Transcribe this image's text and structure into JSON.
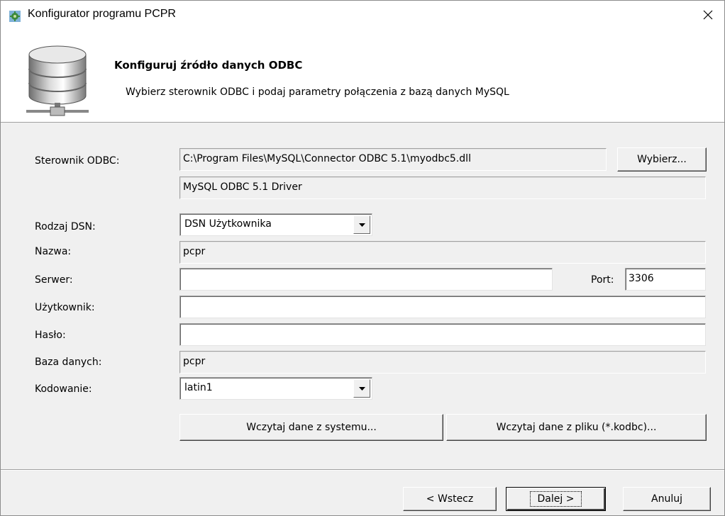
{
  "window": {
    "title": "Konfigurator programu PCPR"
  },
  "header": {
    "title": "Konfiguruj źródło danych ODBC",
    "subtitle": "Wybierz sterownik ODBC i podaj parametry połączenia z bazą danych MySQL"
  },
  "form": {
    "driver_label": "Sterownik ODBC:",
    "driver_path": "C:\\Program Files\\MySQL\\Connector ODBC 5.1\\myodbc5.dll",
    "driver_name": "MySQL ODBC 5.1 Driver",
    "choose_button": "Wybierz...",
    "dsn_type_label": "Rodzaj DSN:",
    "dsn_type_value": "DSN Użytkownika",
    "name_label": "Nazwa:",
    "name_value": "pcpr",
    "server_label": "Serwer:",
    "server_value": "",
    "port_label": "Port:",
    "port_value": "3306",
    "user_label": "Użytkownik:",
    "user_value": "",
    "password_label": "Hasło:",
    "password_value": "",
    "database_label": "Baza danych:",
    "database_value": "pcpr",
    "encoding_label": "Kodowanie:",
    "encoding_value": "latin1",
    "load_system_button": "Wczytaj dane z systemu...",
    "load_file_button": "Wczytaj dane z pliku (*.kodbc)..."
  },
  "footer": {
    "back_button": "< Wstecz",
    "next_button": "Dalej >",
    "cancel_button": "Anuluj"
  },
  "icons": {
    "app": "gear-app-icon",
    "header": "database-network-icon",
    "close": "close-icon",
    "dropdown": "chevron-down-icon"
  }
}
